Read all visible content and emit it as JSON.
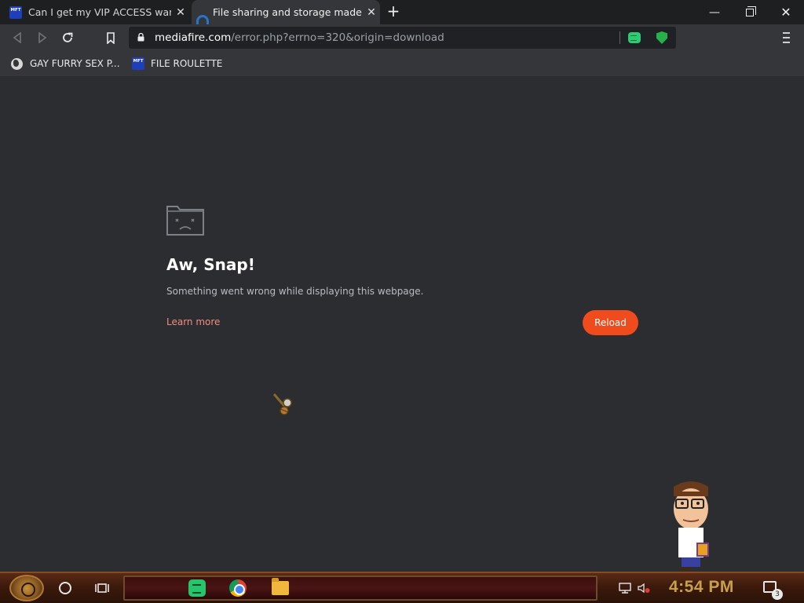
{
  "tabs": [
    {
      "favicon_label": "MFT",
      "title": "Can I get my VIP ACCESS warbe",
      "close": "✕"
    },
    {
      "title": "File sharing and storage made si",
      "close": "✕"
    }
  ],
  "new_tab": "+",
  "window_controls": {
    "minimize": "—",
    "close": "✕"
  },
  "address_bar": {
    "host": "mediafire.com",
    "path": "/error.php?errno=320&origin=download"
  },
  "bookmarks": [
    {
      "icon": "globe-icon",
      "label": "GAY FURRY SEX P..."
    },
    {
      "favicon_label": "MFT",
      "label": "FILE ROULETTE"
    }
  ],
  "error_page": {
    "heading": "Aw, Snap!",
    "message": "Something went wrong while displaying this webpage.",
    "learn_more": "Learn more",
    "reload": "Reload"
  },
  "taskbar": {
    "clock": "4:54 PM",
    "notification_count": "3"
  },
  "colors": {
    "page_bg": "#2c2d30",
    "reload_button": "#f04b1c",
    "learn_more_link": "#f28b82",
    "clock": "#c8a04a"
  }
}
